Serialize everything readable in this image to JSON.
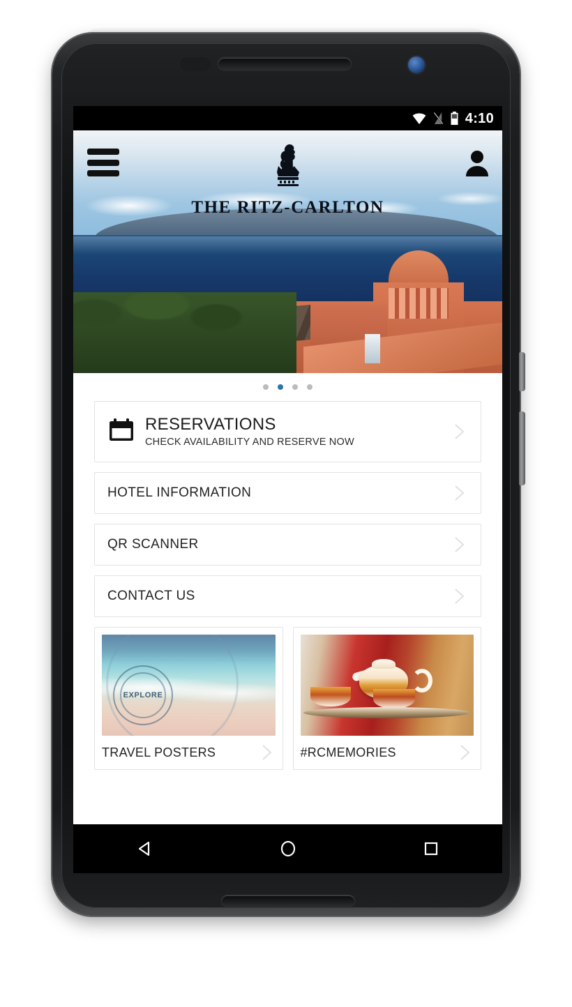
{
  "status_bar": {
    "time": "4:10",
    "icons": [
      "wifi-icon",
      "no-signal-icon",
      "battery-icon"
    ]
  },
  "header": {
    "menu_icon": "hamburger-menu-icon",
    "profile_icon": "profile-icon",
    "brand_name": "THE RITZ-CARLTON",
    "logo_icon": "ritz-carlton-lion-crown-logo"
  },
  "hero": {
    "alt": "Resort overlooking the ocean"
  },
  "carousel": {
    "total_dots": 4,
    "active_index": 1,
    "active_color": "#2a77a8",
    "inactive_color": "#b9bcbf"
  },
  "menu": {
    "reservations": {
      "icon": "calendar-icon",
      "title": "RESERVATIONS",
      "subtitle": "CHECK AVAILABILITY AND RESERVE NOW",
      "chevron": "chevron-right-icon"
    },
    "items": [
      {
        "label": "HOTEL INFORMATION",
        "chevron": "chevron-right-icon"
      },
      {
        "label": "QR SCANNER",
        "chevron": "chevron-right-icon"
      },
      {
        "label": "CONTACT US",
        "chevron": "chevron-right-icon"
      }
    ]
  },
  "tiles": [
    {
      "label": "TRAVEL POSTERS",
      "image_alt": "Beach with Ritz-Carlton explore stamp",
      "stamp_text": "EXPLORE",
      "chevron": "chevron-right-icon"
    },
    {
      "label": "#RCMEMORIES",
      "image_alt": "Ornate teapot and teacups on a tray",
      "chevron": "chevron-right-icon"
    }
  ],
  "nav_bar": {
    "back": "back-triangle-icon",
    "home": "home-circle-icon",
    "recents": "recents-square-icon"
  }
}
